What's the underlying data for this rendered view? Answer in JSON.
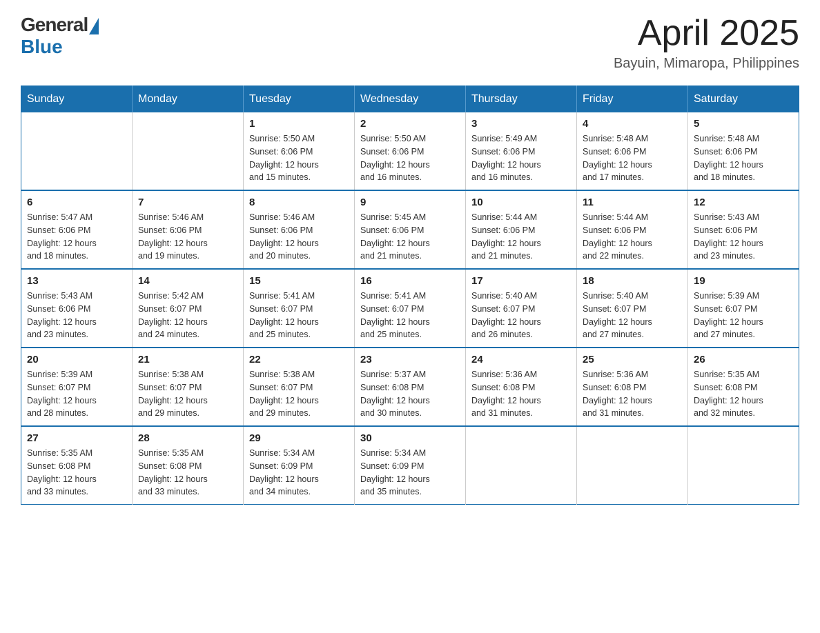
{
  "header": {
    "logo_general": "General",
    "logo_blue": "Blue",
    "title": "April 2025",
    "location": "Bayuin, Mimaropa, Philippines"
  },
  "days_of_week": [
    "Sunday",
    "Monday",
    "Tuesday",
    "Wednesday",
    "Thursday",
    "Friday",
    "Saturday"
  ],
  "weeks": [
    [
      {
        "day": "",
        "info": ""
      },
      {
        "day": "",
        "info": ""
      },
      {
        "day": "1",
        "info": "Sunrise: 5:50 AM\nSunset: 6:06 PM\nDaylight: 12 hours\nand 15 minutes."
      },
      {
        "day": "2",
        "info": "Sunrise: 5:50 AM\nSunset: 6:06 PM\nDaylight: 12 hours\nand 16 minutes."
      },
      {
        "day": "3",
        "info": "Sunrise: 5:49 AM\nSunset: 6:06 PM\nDaylight: 12 hours\nand 16 minutes."
      },
      {
        "day": "4",
        "info": "Sunrise: 5:48 AM\nSunset: 6:06 PM\nDaylight: 12 hours\nand 17 minutes."
      },
      {
        "day": "5",
        "info": "Sunrise: 5:48 AM\nSunset: 6:06 PM\nDaylight: 12 hours\nand 18 minutes."
      }
    ],
    [
      {
        "day": "6",
        "info": "Sunrise: 5:47 AM\nSunset: 6:06 PM\nDaylight: 12 hours\nand 18 minutes."
      },
      {
        "day": "7",
        "info": "Sunrise: 5:46 AM\nSunset: 6:06 PM\nDaylight: 12 hours\nand 19 minutes."
      },
      {
        "day": "8",
        "info": "Sunrise: 5:46 AM\nSunset: 6:06 PM\nDaylight: 12 hours\nand 20 minutes."
      },
      {
        "day": "9",
        "info": "Sunrise: 5:45 AM\nSunset: 6:06 PM\nDaylight: 12 hours\nand 21 minutes."
      },
      {
        "day": "10",
        "info": "Sunrise: 5:44 AM\nSunset: 6:06 PM\nDaylight: 12 hours\nand 21 minutes."
      },
      {
        "day": "11",
        "info": "Sunrise: 5:44 AM\nSunset: 6:06 PM\nDaylight: 12 hours\nand 22 minutes."
      },
      {
        "day": "12",
        "info": "Sunrise: 5:43 AM\nSunset: 6:06 PM\nDaylight: 12 hours\nand 23 minutes."
      }
    ],
    [
      {
        "day": "13",
        "info": "Sunrise: 5:43 AM\nSunset: 6:06 PM\nDaylight: 12 hours\nand 23 minutes."
      },
      {
        "day": "14",
        "info": "Sunrise: 5:42 AM\nSunset: 6:07 PM\nDaylight: 12 hours\nand 24 minutes."
      },
      {
        "day": "15",
        "info": "Sunrise: 5:41 AM\nSunset: 6:07 PM\nDaylight: 12 hours\nand 25 minutes."
      },
      {
        "day": "16",
        "info": "Sunrise: 5:41 AM\nSunset: 6:07 PM\nDaylight: 12 hours\nand 25 minutes."
      },
      {
        "day": "17",
        "info": "Sunrise: 5:40 AM\nSunset: 6:07 PM\nDaylight: 12 hours\nand 26 minutes."
      },
      {
        "day": "18",
        "info": "Sunrise: 5:40 AM\nSunset: 6:07 PM\nDaylight: 12 hours\nand 27 minutes."
      },
      {
        "day": "19",
        "info": "Sunrise: 5:39 AM\nSunset: 6:07 PM\nDaylight: 12 hours\nand 27 minutes."
      }
    ],
    [
      {
        "day": "20",
        "info": "Sunrise: 5:39 AM\nSunset: 6:07 PM\nDaylight: 12 hours\nand 28 minutes."
      },
      {
        "day": "21",
        "info": "Sunrise: 5:38 AM\nSunset: 6:07 PM\nDaylight: 12 hours\nand 29 minutes."
      },
      {
        "day": "22",
        "info": "Sunrise: 5:38 AM\nSunset: 6:07 PM\nDaylight: 12 hours\nand 29 minutes."
      },
      {
        "day": "23",
        "info": "Sunrise: 5:37 AM\nSunset: 6:08 PM\nDaylight: 12 hours\nand 30 minutes."
      },
      {
        "day": "24",
        "info": "Sunrise: 5:36 AM\nSunset: 6:08 PM\nDaylight: 12 hours\nand 31 minutes."
      },
      {
        "day": "25",
        "info": "Sunrise: 5:36 AM\nSunset: 6:08 PM\nDaylight: 12 hours\nand 31 minutes."
      },
      {
        "day": "26",
        "info": "Sunrise: 5:35 AM\nSunset: 6:08 PM\nDaylight: 12 hours\nand 32 minutes."
      }
    ],
    [
      {
        "day": "27",
        "info": "Sunrise: 5:35 AM\nSunset: 6:08 PM\nDaylight: 12 hours\nand 33 minutes."
      },
      {
        "day": "28",
        "info": "Sunrise: 5:35 AM\nSunset: 6:08 PM\nDaylight: 12 hours\nand 33 minutes."
      },
      {
        "day": "29",
        "info": "Sunrise: 5:34 AM\nSunset: 6:09 PM\nDaylight: 12 hours\nand 34 minutes."
      },
      {
        "day": "30",
        "info": "Sunrise: 5:34 AM\nSunset: 6:09 PM\nDaylight: 12 hours\nand 35 minutes."
      },
      {
        "day": "",
        "info": ""
      },
      {
        "day": "",
        "info": ""
      },
      {
        "day": "",
        "info": ""
      }
    ]
  ]
}
